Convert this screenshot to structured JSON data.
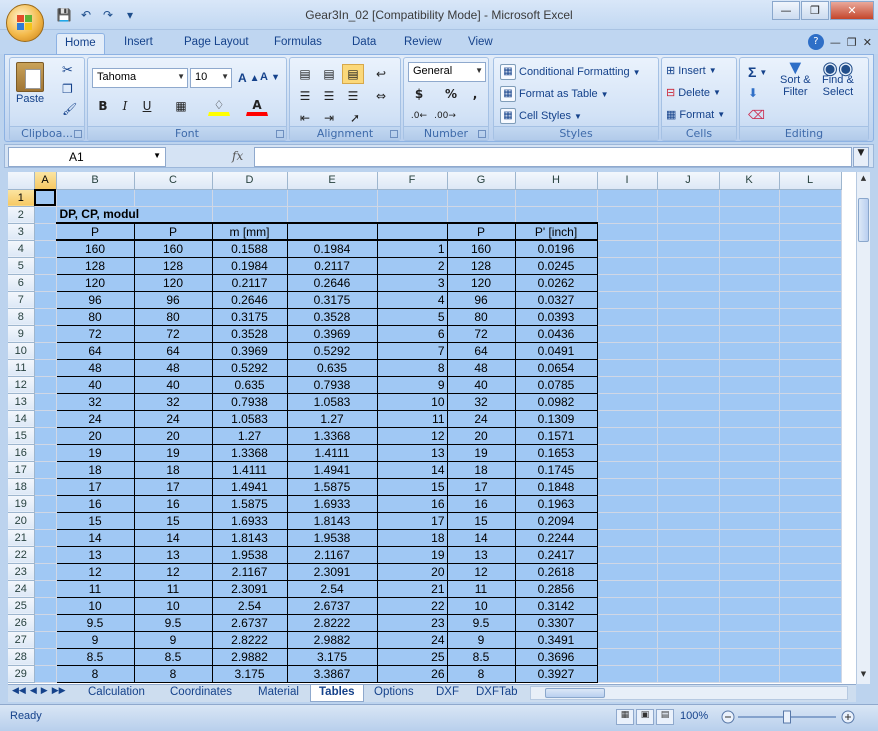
{
  "window": {
    "title": "Gear3In_02  [Compatibility Mode] - Microsoft Excel",
    "controls": [
      "minimize-icon",
      "restore-icon",
      "close-icon"
    ]
  },
  "quick_access": [
    "save-icon",
    "undo-icon",
    "redo-icon",
    "customize-icon"
  ],
  "ribbon_tabs": [
    "Home",
    "Insert",
    "Page Layout",
    "Formulas",
    "Data",
    "Review",
    "View"
  ],
  "active_tab": "Home",
  "ribbon": {
    "clipboard": {
      "label": "Clipboa...",
      "paste": "Paste"
    },
    "font": {
      "label": "Font",
      "name": "Tahoma",
      "size": "10",
      "bold": "B",
      "italic": "I",
      "underline": "U",
      "highlight_color": "#ffff00",
      "font_color": "#ff0000"
    },
    "alignment": {
      "label": "Alignment"
    },
    "number": {
      "label": "Number",
      "format": "General",
      "currency": "$",
      "percent": "%",
      "comma": ","
    },
    "styles": {
      "label": "Styles",
      "conditional": "Conditional Formatting",
      "format_table": "Format as Table",
      "cell_styles": "Cell Styles"
    },
    "cells": {
      "label": "Cells",
      "insert": "Insert",
      "delete": "Delete",
      "format": "Format"
    },
    "editing": {
      "label": "Editing",
      "sigma": "Σ",
      "sort": "Sort &",
      "filter": "Filter",
      "find": "Find &",
      "select": "Select"
    }
  },
  "formula_bar": {
    "name_box": "A1",
    "fx": "fx",
    "content": ""
  },
  "columns": [
    "A",
    "B",
    "C",
    "D",
    "E",
    "F",
    "G",
    "H",
    "I",
    "J",
    "K",
    "L"
  ],
  "sheet": {
    "title_cell": "DP, CP, modul",
    "headers": {
      "b": "P",
      "c": "P",
      "d": "m [mm]",
      "e": "",
      "f": "",
      "g": "P",
      "h": "P' [inch]"
    },
    "rows": [
      {
        "n": "4",
        "b": "160",
        "c": "160",
        "d": "0.1588",
        "e": "0.1984",
        "f": "1",
        "g": "160",
        "h": "0.0196"
      },
      {
        "n": "5",
        "b": "128",
        "c": "128",
        "d": "0.1984",
        "e": "0.2117",
        "f": "2",
        "g": "128",
        "h": "0.0245"
      },
      {
        "n": "6",
        "b": "120",
        "c": "120",
        "d": "0.2117",
        "e": "0.2646",
        "f": "3",
        "g": "120",
        "h": "0.0262"
      },
      {
        "n": "7",
        "b": "96",
        "c": "96",
        "d": "0.2646",
        "e": "0.3175",
        "f": "4",
        "g": "96",
        "h": "0.0327"
      },
      {
        "n": "8",
        "b": "80",
        "c": "80",
        "d": "0.3175",
        "e": "0.3528",
        "f": "5",
        "g": "80",
        "h": "0.0393"
      },
      {
        "n": "9",
        "b": "72",
        "c": "72",
        "d": "0.3528",
        "e": "0.3969",
        "f": "6",
        "g": "72",
        "h": "0.0436"
      },
      {
        "n": "10",
        "b": "64",
        "c": "64",
        "d": "0.3969",
        "e": "0.5292",
        "f": "7",
        "g": "64",
        "h": "0.0491"
      },
      {
        "n": "11",
        "b": "48",
        "c": "48",
        "d": "0.5292",
        "e": "0.635",
        "f": "8",
        "g": "48",
        "h": "0.0654"
      },
      {
        "n": "12",
        "b": "40",
        "c": "40",
        "d": "0.635",
        "e": "0.7938",
        "f": "9",
        "g": "40",
        "h": "0.0785"
      },
      {
        "n": "13",
        "b": "32",
        "c": "32",
        "d": "0.7938",
        "e": "1.0583",
        "f": "10",
        "g": "32",
        "h": "0.0982"
      },
      {
        "n": "14",
        "b": "24",
        "c": "24",
        "d": "1.0583",
        "e": "1.27",
        "f": "11",
        "g": "24",
        "h": "0.1309"
      },
      {
        "n": "15",
        "b": "20",
        "c": "20",
        "d": "1.27",
        "e": "1.3368",
        "f": "12",
        "g": "20",
        "h": "0.1571"
      },
      {
        "n": "16",
        "b": "19",
        "c": "19",
        "d": "1.3368",
        "e": "1.4111",
        "f": "13",
        "g": "19",
        "h": "0.1653"
      },
      {
        "n": "17",
        "b": "18",
        "c": "18",
        "d": "1.4111",
        "e": "1.4941",
        "f": "14",
        "g": "18",
        "h": "0.1745"
      },
      {
        "n": "18",
        "b": "17",
        "c": "17",
        "d": "1.4941",
        "e": "1.5875",
        "f": "15",
        "g": "17",
        "h": "0.1848"
      },
      {
        "n": "19",
        "b": "16",
        "c": "16",
        "d": "1.5875",
        "e": "1.6933",
        "f": "16",
        "g": "16",
        "h": "0.1963"
      },
      {
        "n": "20",
        "b": "15",
        "c": "15",
        "d": "1.6933",
        "e": "1.8143",
        "f": "17",
        "g": "15",
        "h": "0.2094"
      },
      {
        "n": "21",
        "b": "14",
        "c": "14",
        "d": "1.8143",
        "e": "1.9538",
        "f": "18",
        "g": "14",
        "h": "0.2244"
      },
      {
        "n": "22",
        "b": "13",
        "c": "13",
        "d": "1.9538",
        "e": "2.1167",
        "f": "19",
        "g": "13",
        "h": "0.2417"
      },
      {
        "n": "23",
        "b": "12",
        "c": "12",
        "d": "2.1167",
        "e": "2.3091",
        "f": "20",
        "g": "12",
        "h": "0.2618"
      },
      {
        "n": "24",
        "b": "11",
        "c": "11",
        "d": "2.3091",
        "e": "2.54",
        "f": "21",
        "g": "11",
        "h": "0.2856"
      },
      {
        "n": "25",
        "b": "10",
        "c": "10",
        "d": "2.54",
        "e": "2.6737",
        "f": "22",
        "g": "10",
        "h": "0.3142"
      },
      {
        "n": "26",
        "b": "9.5",
        "c": "9.5",
        "d": "2.6737",
        "e": "2.8222",
        "f": "23",
        "g": "9.5",
        "h": "0.3307"
      },
      {
        "n": "27",
        "b": "9",
        "c": "9",
        "d": "2.8222",
        "e": "2.9882",
        "f": "24",
        "g": "9",
        "h": "0.3491"
      },
      {
        "n": "28",
        "b": "8.5",
        "c": "8.5",
        "d": "2.9882",
        "e": "3.175",
        "f": "25",
        "g": "8.5",
        "h": "0.3696"
      },
      {
        "n": "29",
        "b": "8",
        "c": "8",
        "d": "3.175",
        "e": "3.3867",
        "f": "26",
        "g": "8",
        "h": "0.3927"
      }
    ]
  },
  "sheet_tabs": [
    "Calculation",
    "Coordinates",
    "Material",
    "Tables",
    "Options",
    "DXF",
    "DXFTab"
  ],
  "active_sheet": "Tables",
  "status": {
    "text": "Ready",
    "zoom": "100%",
    "zoom_level_percent": 100
  },
  "colors": {
    "cell_fill": "#a0c8f4",
    "ribbon": "#dbe8f7",
    "accent": "#15428b"
  }
}
